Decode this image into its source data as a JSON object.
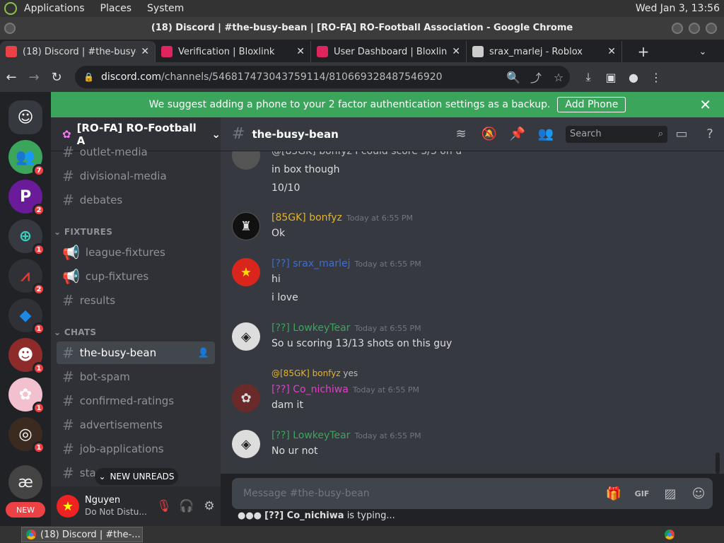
{
  "os": {
    "menus": [
      "Applications",
      "Places",
      "System"
    ],
    "clock": "Wed Jan  3, 13:56"
  },
  "window": {
    "title": "(18) Discord | #the-busy-bean | [RO-FA] RO-Football Association - Google Chrome"
  },
  "tabs": [
    {
      "label": "(18) Discord | #the-busy-b",
      "color": "#ed4245"
    },
    {
      "label": "Verification | Bloxlink",
      "color": "#e0245e"
    },
    {
      "label": "User Dashboard | Bloxlink",
      "color": "#e0245e"
    },
    {
      "label": "srax_marlej - Roblox",
      "color": "#cccccc"
    }
  ],
  "address": {
    "domain": "discord.com",
    "path": "/channels/546817473043759114/810669328487546920"
  },
  "notice": {
    "text": "We suggest adding a phone to your 2 factor authentication settings as a backup.",
    "button": "Add Phone"
  },
  "server": {
    "name": "[RO-FA] RO-Football A"
  },
  "guild_badges": [
    "7",
    "2",
    "1",
    "2",
    "1",
    "1",
    "1",
    "1"
  ],
  "guild_new_label": "NEW",
  "channels": {
    "top": [
      "outlet-media",
      "divisional-media",
      "debates"
    ],
    "fixtures_label": "FIXTURES",
    "fixtures": [
      "league-fixtures",
      "cup-fixtures",
      "results"
    ],
    "chats_label": "CHATS",
    "chats": [
      "the-busy-bean",
      "bot-spam",
      "confirmed-ratings",
      "advertisements",
      "job-applications",
      "sta"
    ]
  },
  "new_unreads": "NEW UNREADS",
  "user": {
    "name": "Nguyen",
    "status": "Do Not Distu..."
  },
  "chat_header": {
    "channel": "the-busy-bean",
    "search_placeholder": "Search"
  },
  "messages": {
    "partial_reply": "@[85GK] bonfyz I could score 3/3 on u",
    "partial_lines": [
      "in box though",
      "10/10"
    ],
    "m1": {
      "author": "[85GK] bonfyz",
      "time": "Today at 6:55 PM",
      "lines": [
        "Ok"
      ]
    },
    "m2": {
      "author": "[??] srax_marlej",
      "time": "Today at 6:55 PM",
      "lines": [
        "hi",
        "i love"
      ]
    },
    "m3": {
      "author": "[??] LowkeyTear",
      "time": "Today at 6:55 PM",
      "lines": [
        "So u scoring 13/13 shots on this guy"
      ]
    },
    "m4": {
      "reply_to": "@[85GK] bonfyz",
      "reply_text": "yes",
      "author": "[??] Co_nichiwa",
      "time": "Today at 6:55 PM",
      "lines": [
        "dam it"
      ]
    },
    "m5": {
      "author": "[??] LowkeyTear",
      "time": "Today at 6:55 PM",
      "lines": [
        "No ur not"
      ]
    }
  },
  "input": {
    "placeholder": "Message #the-busy-bean"
  },
  "typing": {
    "user": "[??] Co_nichiwa",
    "text": "is typing..."
  },
  "taskbar": {
    "task": "(18) Discord | #the-..."
  },
  "colors": {
    "green": "#3ba55c",
    "gold": "#e3b32a",
    "blue": "#3b6fd6",
    "teal": "#3ba55c",
    "pink": "#e040c8"
  }
}
